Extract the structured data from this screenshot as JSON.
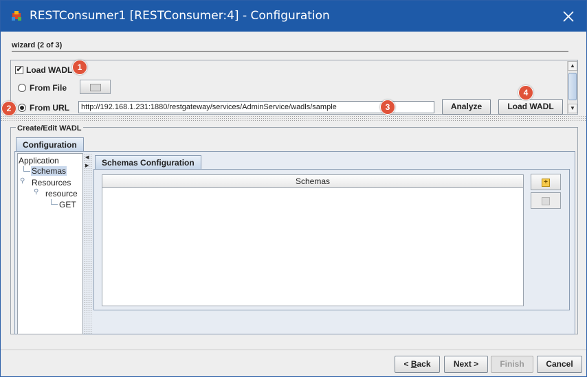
{
  "window": {
    "title": "RESTConsumer1 [RESTConsumer:4] - Configuration",
    "close_icon": "close-icon",
    "app_icon": "app-icon"
  },
  "wizard": {
    "label": "wizard (2 of 3)"
  },
  "load_section": {
    "load_wadl_label": "Load WADL",
    "load_wadl_checked": true,
    "from_file_label": "From File",
    "from_url_label": "From URL",
    "selected_source": "From URL",
    "url_value": "http://192.168.1.231:1880/restgateway/services/AdminService/wadls/sample",
    "analyze_label": "Analyze",
    "load_wadl_button_label": "Load WADL"
  },
  "badges": {
    "b1": "1",
    "b2": "2",
    "b3": "3",
    "b4": "4",
    "color": "#e0533a"
  },
  "edit_section": {
    "group_title": "Create/Edit WADL",
    "tab_label": "Configuration",
    "tree": {
      "root": "Application",
      "schemas": "Schemas",
      "resources": "Resources",
      "resource": "resource",
      "get": "GET"
    },
    "inner_tab_label": "Schemas Configuration",
    "grid_header": "Schemas",
    "add_icon": "add-icon",
    "remove_icon": "remove-icon"
  },
  "footer": {
    "back_prefix": "< ",
    "back_mnemonic": "B",
    "back_rest": "ack",
    "next_label": "Next >",
    "finish_label": "Finish",
    "cancel_label": "Cancel"
  },
  "colors": {
    "titlebar": "#1e5aa8",
    "selection": "#c9d8ec"
  }
}
